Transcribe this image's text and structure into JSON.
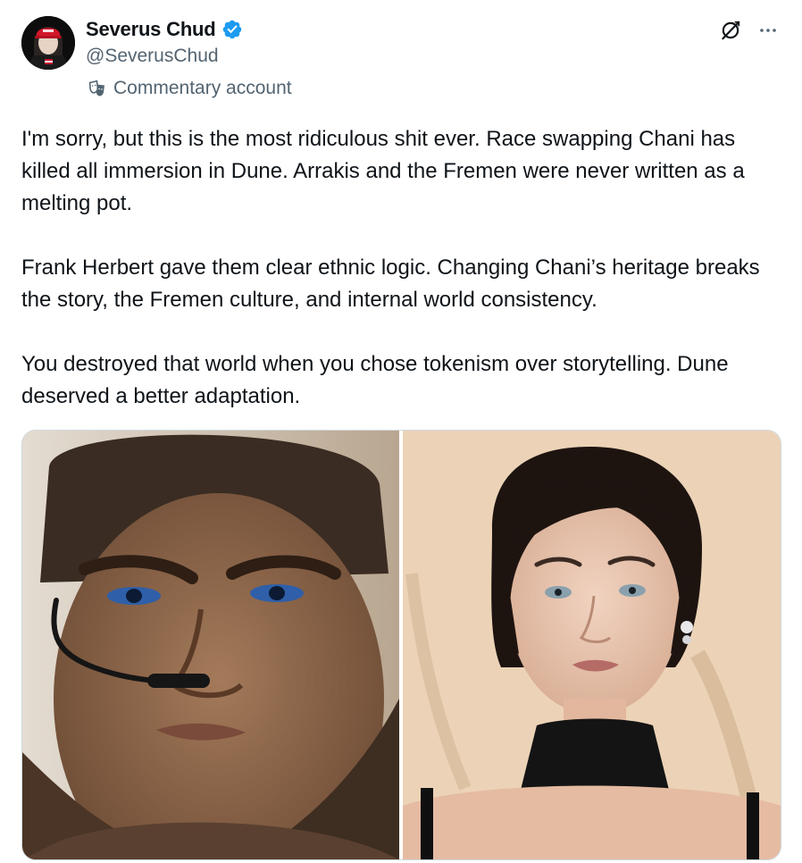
{
  "author": {
    "display_name": "Severus Chud",
    "handle": "@SeverusChud",
    "verified": true,
    "label": "Commentary account",
    "label_icon": "theater-masks-icon"
  },
  "actions": {
    "grok_icon": "grok-icon",
    "more_icon": "more-icon"
  },
  "tweet": {
    "paragraphs": [
      "I'm sorry, but this is the most ridiculous shit ever. Race swapping Chani has killed all immersion in Dune. Arrakis and the Fremen were never written as a melting pot.",
      "Frank Herbert gave them clear ethnic logic. Changing Chani’s heritage breaks the story, the Fremen culture, and internal world consistency.",
      "You destroyed that world when you chose tokenism over storytelling. Dune deserved a better adaptation."
    ]
  },
  "colors": {
    "text": "#0f1419",
    "secondary": "#536471",
    "verified_blue": "#1d9bf0",
    "border": "#cfd9de"
  }
}
